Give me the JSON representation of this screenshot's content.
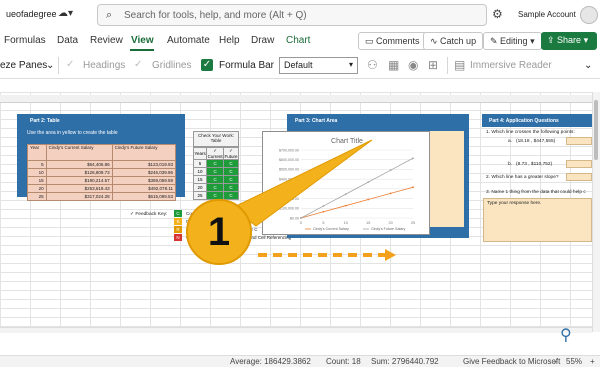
{
  "titlebar": {
    "workbook": "ueofadegree",
    "search_placeholder": "Search for tools, help, and more (Alt + Q)",
    "account": "Sample Account"
  },
  "tabs": [
    "Formulas",
    "Data",
    "Review",
    "View",
    "Automate",
    "Help",
    "Draw",
    "Chart"
  ],
  "tab_actions": {
    "comments": "Comments",
    "catchup": "Catch up",
    "editing": "Editing",
    "share": "Share"
  },
  "ribbon": {
    "freeze_panes": "eze Panes",
    "headings": "Headings",
    "gridlines": "Gridlines",
    "formula_bar": "Formula Bar",
    "style_dropdown": "Default",
    "immersive_reader": "Immersive Reader"
  },
  "sheet": {
    "part2": {
      "title": "Part 2: Table",
      "instruction": "Use the area in yellow to create the table"
    },
    "table": {
      "headers": [
        "Year",
        "Cindy's Current Salary",
        "Cindy's Future Salary"
      ],
      "rows": [
        [
          "5",
          "$64,406.86",
          "$123,019.93"
        ],
        [
          "10",
          "$126,809.73",
          "$246,039.86"
        ],
        [
          "15",
          "$190,214.57",
          "$369,059.59"
        ],
        [
          "20",
          "$253,619.43",
          "$492,078.11"
        ],
        [
          "25",
          "$317,024.28",
          "$615,099.53"
        ]
      ]
    },
    "check": {
      "title": "Check Your Work: Table",
      "headers": [
        "Years",
        "Current",
        "Future"
      ],
      "check_mark": "✓",
      "rows": [
        [
          "5",
          "C",
          "C"
        ],
        [
          "10",
          "C",
          "C"
        ],
        [
          "15",
          "C",
          "C"
        ],
        [
          "20",
          "C",
          "C"
        ],
        [
          "25",
          "C",
          "C"
        ]
      ]
    },
    "feedback": {
      "label": "Feedback Key:",
      "keys": [
        {
          "code": "C",
          "color": "#1e9c3a",
          "text": "Co"
        },
        {
          "code": "S",
          "color": "#f3b21c",
          "text": "C"
        },
        {
          "code": "R",
          "color": "#e09a00",
          "text": "C"
        },
        {
          "code": "N",
          "color": "#d83232",
          "text": "C"
        }
      ],
      "partial_1": "er C",
      "partial_2": "and Cell Referencing"
    },
    "part3": {
      "title": "Part 3: Chart Area"
    },
    "part4": {
      "title": "Part 4: Application Questions",
      "q1": "1. Which line crosses the following points:",
      "q1a_label": "a.",
      "q1a_value": "(18.18 , $447,555)",
      "q1b_label": "b.",
      "q1b_value": "(8.73 , $110,752)",
      "q2": "2. Which line has a greater slope?",
      "q3": "3. Name 1 thing from the data that could help c",
      "response": "Type your response here."
    }
  },
  "chart_data": {
    "type": "line",
    "title": "Chart Title",
    "categories": [
      "0",
      "5",
      "10",
      "15",
      "20",
      "25"
    ],
    "ylim": [
      0,
      700000
    ],
    "yticks": [
      "$0.00",
      "$100,000.00",
      "$200,000.00",
      "$300,000.00",
      "$400,000.00",
      "$500,000.00",
      "$600,000.00",
      "$700,000.00"
    ],
    "series": [
      {
        "name": "Cindy's Current Salary",
        "color": "#ed7d31",
        "values": [
          0,
          64406.86,
          126809.73,
          190214.57,
          253619.43,
          317024.28
        ]
      },
      {
        "name": "Cindy's Future Salary",
        "color": "#a5a5a5",
        "values": [
          0,
          123019.93,
          246039.86,
          369059.59,
          492078.11,
          615099.53
        ]
      }
    ],
    "legend": "bottom",
    "grid": true
  },
  "callout": {
    "number": "1"
  },
  "status": {
    "average": "Average: 186429.3862",
    "count": "Count: 18",
    "sum": "Sum: 2796440.792",
    "feedback": "Give Feedback to Microsoft",
    "zoom": "55%"
  },
  "colors": {
    "accent": "#1b7a3f",
    "panel_blue": "#2f6fa8",
    "table_fill": "#f3d0bf",
    "ok_green": "#1e9c3a",
    "callout": "#f3b21c"
  }
}
